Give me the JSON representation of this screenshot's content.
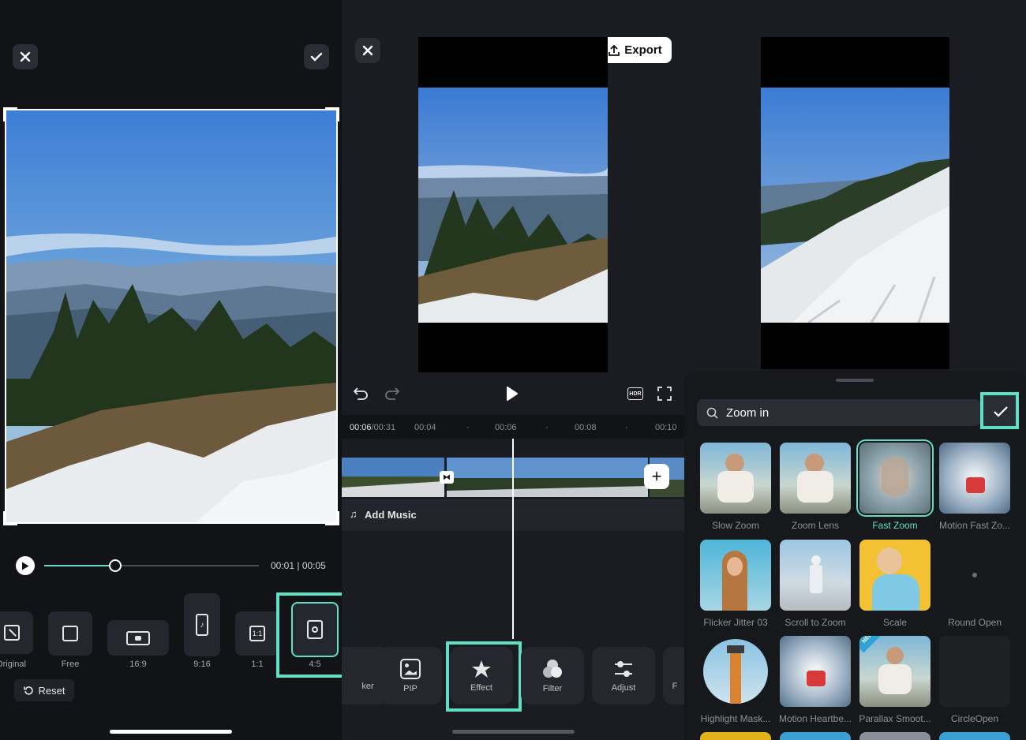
{
  "crop": {
    "time": "00:01 | 00:05",
    "progress_fraction": 0.33,
    "reset_label": "Reset",
    "ratios": [
      {
        "label": "Original",
        "icon": "original-ratio-icon"
      },
      {
        "label": "Free",
        "icon": "free-ratio-icon"
      },
      {
        "label": "16:9",
        "icon": "youtube-icon"
      },
      {
        "label": "9:16",
        "icon": "tiktok-icon"
      },
      {
        "label": "1:1",
        "icon": "square-ratio-icon"
      },
      {
        "label": "4:5",
        "icon": "instagram-icon",
        "selected": true
      }
    ]
  },
  "editor": {
    "export_label": "Export",
    "current_time": "00:06",
    "total_time": "/00:31",
    "ruler_ticks": [
      "00:04",
      "00:06",
      "00:08",
      "00:10"
    ],
    "add_music_label": "Add Music",
    "tools": [
      {
        "label": "ker",
        "icon": "sticker-icon"
      },
      {
        "label": "PIP",
        "icon": "pip-icon"
      },
      {
        "label": "Effect",
        "icon": "effect-icon",
        "selected": true
      },
      {
        "label": "Filter",
        "icon": "filter-icon"
      },
      {
        "label": "Adjust",
        "icon": "adjust-icon"
      },
      {
        "label": "F",
        "icon": "more-icon"
      }
    ]
  },
  "effects": {
    "search_value": "Zoom in",
    "items": [
      {
        "label": "Slow Zoom"
      },
      {
        "label": "Zoom Lens"
      },
      {
        "label": "Fast Zoom",
        "selected": true
      },
      {
        "label": "Motion Fast Zo..."
      },
      {
        "label": "Flicker Jitter 03"
      },
      {
        "label": "Scroll to Zoom"
      },
      {
        "label": "Scale"
      },
      {
        "label": "Round Open"
      },
      {
        "label": "Highlight Mask..."
      },
      {
        "label": "Motion Heartbe..."
      },
      {
        "label": "Parallax Smoot..."
      },
      {
        "label": "CircleOpen"
      }
    ],
    "badge_new": "NEW"
  },
  "colors": {
    "accent": "#5ee0c4",
    "panel_bg": "#111316",
    "editor_bg": "#1a1c21"
  }
}
